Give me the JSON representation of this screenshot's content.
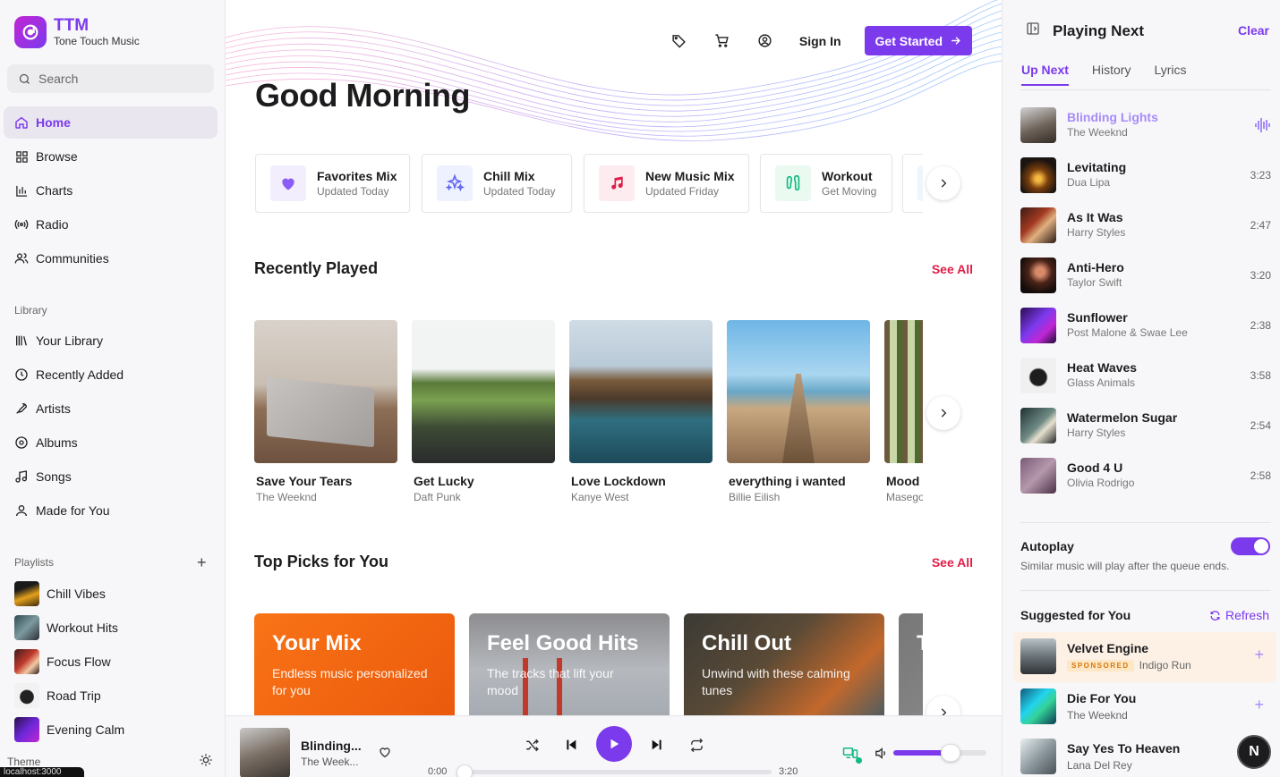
{
  "app": {
    "name": "TTM",
    "subtitle": "Tone Touch Music"
  },
  "search": {
    "placeholder": "Search"
  },
  "nav": {
    "home": "Home",
    "browse": "Browse",
    "charts": "Charts",
    "radio": "Radio",
    "communities": "Communities"
  },
  "library": {
    "label": "Library",
    "items": [
      "Your Library",
      "Recently Added",
      "Artists",
      "Albums",
      "Songs",
      "Made for You"
    ]
  },
  "playlists": {
    "label": "Playlists",
    "items": [
      "Chill Vibes",
      "Workout Hits",
      "Focus Flow",
      "Road Trip",
      "Evening Calm"
    ]
  },
  "theme_label": "Theme",
  "dev_badge": "localhost:3000",
  "header": {
    "sign_in": "Sign In",
    "get_started": "Get Started"
  },
  "greeting": "Good Morning",
  "mixes": [
    {
      "title": "Favorites Mix",
      "sub": "Updated Today"
    },
    {
      "title": "Chill Mix",
      "sub": "Updated Today"
    },
    {
      "title": "New Music Mix",
      "sub": "Updated Friday"
    },
    {
      "title": "Workout",
      "sub": "Get Moving"
    }
  ],
  "recently_played": {
    "title": "Recently Played",
    "see_all": "See All",
    "items": [
      {
        "title": "Save Your Tears",
        "artist": "The Weeknd"
      },
      {
        "title": "Get Lucky",
        "artist": "Daft Punk"
      },
      {
        "title": "Love Lockdown",
        "artist": "Kanye West"
      },
      {
        "title": "everything i wanted",
        "artist": "Billie Eilish"
      },
      {
        "title": "Mood",
        "artist": "Masego"
      }
    ]
  },
  "top_picks": {
    "title": "Top Picks for You",
    "see_all": "See All",
    "items": [
      {
        "title": "Your Mix",
        "sub": "Endless music personalized for you"
      },
      {
        "title": "Feel Good Hits",
        "sub": "The tracks that lift your mood"
      },
      {
        "title": "Chill Out",
        "sub": "Unwind with these calming tunes"
      },
      {
        "title": "T",
        "sub": ""
      }
    ]
  },
  "player": {
    "title": "Blinding...",
    "artist": "The Week...",
    "elapsed": "0:00",
    "duration": "3:20",
    "progress": 0,
    "volume": 0.62
  },
  "panel": {
    "title": "Playing Next",
    "clear": "Clear",
    "tabs": [
      "Up Next",
      "History",
      "Lyrics"
    ],
    "queue": [
      {
        "title": "Blinding Lights",
        "artist": "The Weeknd",
        "duration": ""
      },
      {
        "title": "Levitating",
        "artist": "Dua Lipa",
        "duration": "3:23"
      },
      {
        "title": "As It Was",
        "artist": "Harry Styles",
        "duration": "2:47"
      },
      {
        "title": "Anti-Hero",
        "artist": "Taylor Swift",
        "duration": "3:20"
      },
      {
        "title": "Sunflower",
        "artist": "Post Malone & Swae Lee",
        "duration": "2:38"
      },
      {
        "title": "Heat Waves",
        "artist": "Glass Animals",
        "duration": "3:58"
      },
      {
        "title": "Watermelon Sugar",
        "artist": "Harry Styles",
        "duration": "2:54"
      },
      {
        "title": "Good 4 U",
        "artist": "Olivia Rodrigo",
        "duration": "2:58"
      }
    ],
    "autoplay": {
      "title": "Autoplay",
      "sub": "Similar music will play after the queue ends.",
      "on": true
    },
    "suggested": {
      "title": "Suggested for You",
      "refresh": "Refresh",
      "items": [
        {
          "title": "Velvet Engine",
          "badge": "SPONSORED",
          "artist": "Indigo Run"
        },
        {
          "title": "Die For You",
          "artist": "The Weeknd"
        },
        {
          "title": "Say Yes To Heaven",
          "artist": "Lana Del Rey"
        }
      ]
    }
  },
  "colors": {
    "accent": "#7c3aed",
    "see_all": "#e11d48",
    "sponsored_bg": "#fdf1e6"
  }
}
